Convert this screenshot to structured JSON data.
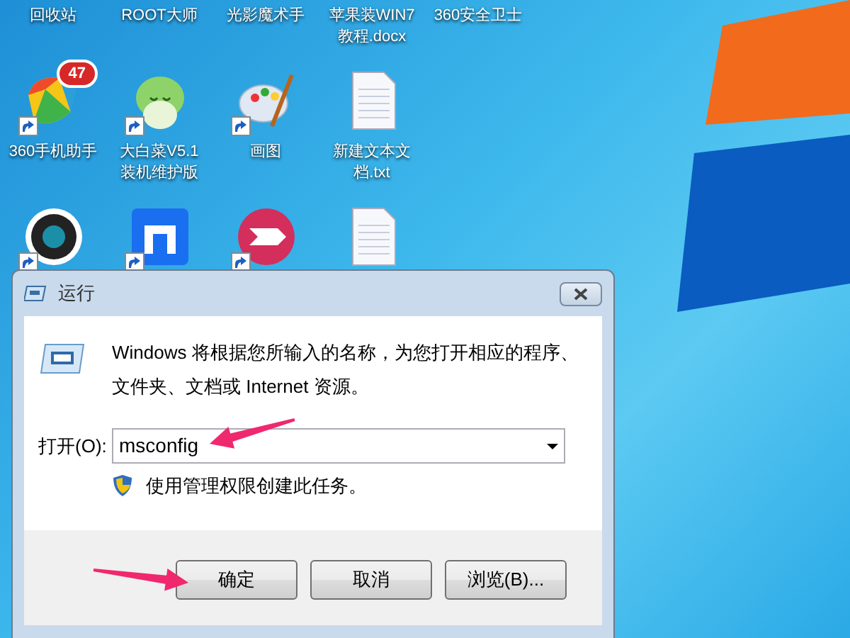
{
  "desktop_icons": [
    {
      "label": "回收站",
      "kind": "hidden"
    },
    {
      "label": "ROOT大师",
      "kind": "hidden"
    },
    {
      "label": "光影魔术手",
      "kind": "hidden"
    },
    {
      "label": "苹果装WIN7教程.docx",
      "kind": "hidden"
    },
    {
      "label": "360安全卫士",
      "kind": "hidden"
    },
    {
      "label": "360手机助手",
      "kind": "phone-assistant",
      "shortcut": true,
      "badge": "47"
    },
    {
      "label": "大白菜V5.1装机维护版",
      "kind": "cabbage",
      "shortcut": true
    },
    {
      "label": "画图",
      "kind": "paint",
      "shortcut": true
    },
    {
      "label": "新建文本文档.txt",
      "kind": "text-file",
      "shortcut": false
    },
    {
      "kind": "empty"
    },
    {
      "kind": "webcam",
      "shortcut": true
    },
    {
      "kind": "browser",
      "shortcut": true
    },
    {
      "kind": "arrows-app",
      "shortcut": true
    },
    {
      "kind": "text-file",
      "shortcut": false
    }
  ],
  "dialog": {
    "title": "运行",
    "message_lines": [
      "Windows 将根据您所输入的名称，为您打开相应的程序、",
      "文件夹、文档或 Internet 资源。"
    ],
    "open_label": "打开(O):",
    "open_value": "msconfig",
    "admin_note": "使用管理权限创建此任务。",
    "buttons": [
      {
        "label": "确定"
      },
      {
        "label": "取消"
      },
      {
        "label": "浏览(B)..."
      }
    ]
  }
}
